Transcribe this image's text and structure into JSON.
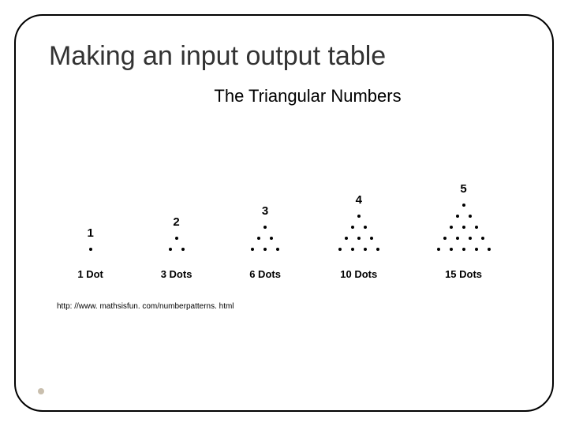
{
  "title": "Making an input output table",
  "subtitle": "The Triangular Numbers",
  "triangles": [
    {
      "index": "1",
      "rows": 1,
      "label": "1 Dot"
    },
    {
      "index": "2",
      "rows": 2,
      "label": "3 Dots"
    },
    {
      "index": "3",
      "rows": 3,
      "label": "6 Dots"
    },
    {
      "index": "4",
      "rows": 4,
      "label": "10 Dots"
    },
    {
      "index": "5",
      "rows": 5,
      "label": "15 Dots"
    }
  ],
  "source": "http: //www. mathsisfun. com/numberpatterns. html"
}
